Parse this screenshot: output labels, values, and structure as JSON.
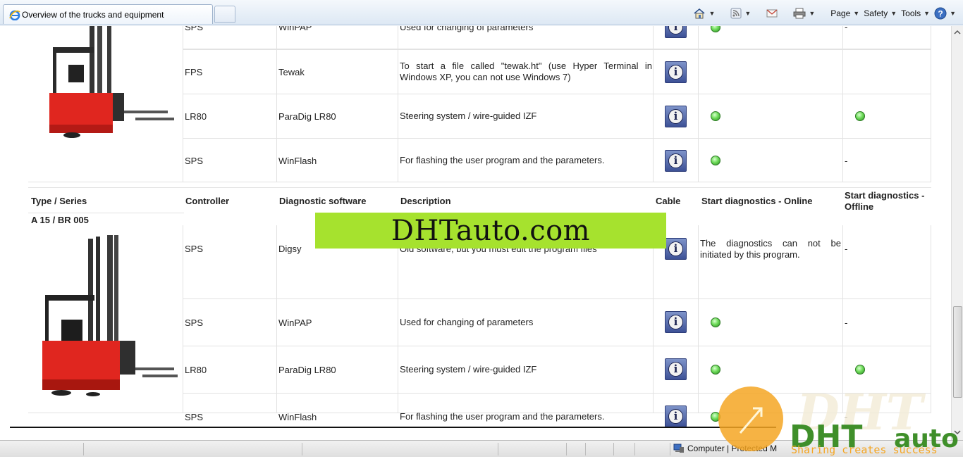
{
  "browser": {
    "tab_title": "Overview of the trucks and equipment",
    "commands": {
      "page": "Page",
      "safety": "Safety",
      "tools": "Tools"
    }
  },
  "table_top": {
    "rows": [
      {
        "controller": "SPS",
        "software": "WinPAP",
        "description": "Used for changing of parameters",
        "online": true,
        "offline": "-"
      },
      {
        "controller": "FPS",
        "software": "Tewak",
        "description": "To start a file called \"tewak.ht\" (use Hyper Terminal in Windows XP, you can not use Windows 7)",
        "online": false,
        "offline": ""
      },
      {
        "controller": "LR80",
        "software": "ParaDig LR80",
        "description": "Steering system / wire-guided IZF",
        "online": true,
        "offline": "dot"
      },
      {
        "controller": "SPS",
        "software": "WinFlash",
        "description": "For flashing the user program and the parameters.",
        "online": true,
        "offline": "-"
      }
    ]
  },
  "header": {
    "type_series": "Type / Series",
    "controller": "Controller",
    "diagnostic_software": "Diagnostic software",
    "description": "Description",
    "cable": "Cable",
    "online": "Start diagnostics - Online",
    "offline_line1": "Start diagnostics -",
    "offline_line2": "Offline"
  },
  "section": {
    "series_name": "A 15 / BR 005",
    "rows": [
      {
        "controller": "SPS",
        "software": "Digsy",
        "description": "Old software, but you must edit the program files",
        "online_text": "The diagnostics can not be initiated by this program.",
        "offline": "-"
      },
      {
        "controller": "SPS",
        "software": "WinPAP",
        "description": "Used for changing of parameters",
        "online": true,
        "offline": "-"
      },
      {
        "controller": "LR80",
        "software": "ParaDig LR80",
        "description": "Steering system / wire-guided IZF",
        "online": true,
        "offline": "dot"
      },
      {
        "controller": "SPS",
        "software": "WinFlash",
        "description": "For flashing the user program and the parameters.",
        "online": true,
        "offline": "-"
      }
    ]
  },
  "watermark": {
    "banner_text": "DHTauto.com",
    "logo_text_dht": "DHT",
    "logo_text_auto": "auto",
    "logo_tagline": "Sharing creates success",
    "logo_big": "DHT"
  },
  "status": {
    "zone_text": "Computer | Protected M"
  },
  "colors": {
    "banner": "#a6e22e",
    "truck_red": "#e0261f",
    "online_dot": "#4cc23a"
  }
}
